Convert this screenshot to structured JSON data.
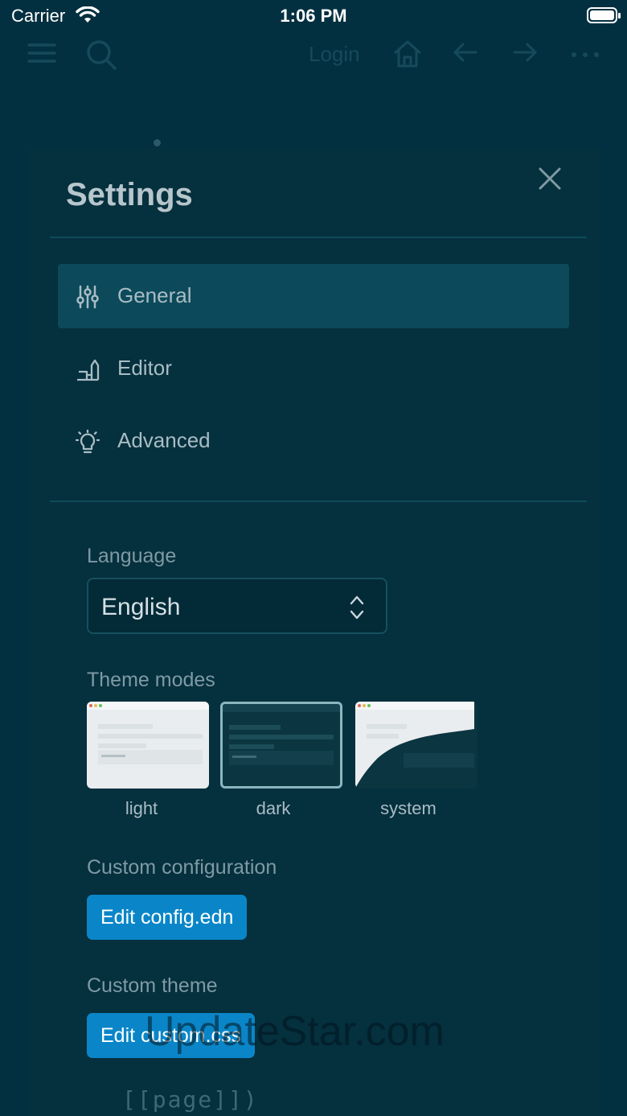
{
  "status_bar": {
    "carrier": "Carrier",
    "time": "1:06 PM"
  },
  "toolbar": {
    "login_label": "Login"
  },
  "settings": {
    "title": "Settings",
    "nav": [
      {
        "label": "General",
        "icon": "sliders-icon",
        "active": true
      },
      {
        "label": "Editor",
        "icon": "editor-icon",
        "active": false
      },
      {
        "label": "Advanced",
        "icon": "lightbulb-icon",
        "active": false
      }
    ],
    "language": {
      "label": "Language",
      "selected": "English"
    },
    "theme_modes": {
      "label": "Theme modes",
      "options": [
        {
          "caption": "light",
          "selected": false
        },
        {
          "caption": "dark",
          "selected": true
        },
        {
          "caption": "system",
          "selected": false
        }
      ]
    },
    "custom_configuration": {
      "label": "Custom configuration",
      "button": "Edit config.edn"
    },
    "custom_theme": {
      "label": "Custom theme",
      "button": "Edit custom.css"
    }
  },
  "background_text": "[[page]])",
  "watermark": "UpdateStar.com",
  "colors": {
    "background": "#023040",
    "modal": "#05303e",
    "accent_button": "#0a86c8",
    "active_nav": "#0c4a5b"
  }
}
